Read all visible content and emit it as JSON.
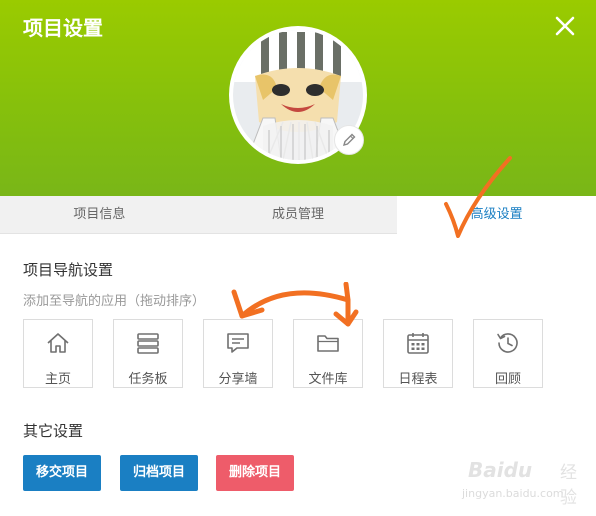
{
  "dialog": {
    "title": "项目设置"
  },
  "tabs": [
    {
      "label": "项目信息",
      "active": false
    },
    {
      "label": "成员管理",
      "active": false
    },
    {
      "label": "高级设置",
      "active": true
    }
  ],
  "nav_settings": {
    "heading": "项目导航设置",
    "hint": "添加至导航的应用（拖动排序）",
    "apps": [
      {
        "label": "主页",
        "icon": "home-icon"
      },
      {
        "label": "任务板",
        "icon": "task-board-icon"
      },
      {
        "label": "分享墙",
        "icon": "share-wall-icon"
      },
      {
        "label": "文件库",
        "icon": "folder-icon"
      },
      {
        "label": "日程表",
        "icon": "calendar-icon"
      },
      {
        "label": "回顾",
        "icon": "history-icon"
      }
    ]
  },
  "other_settings": {
    "heading": "其它设置",
    "transfer_label": "移交项目",
    "archive_label": "归档项目",
    "delete_label": "删除项目"
  },
  "watermark": {
    "brand": "Baidu",
    "suffix": "经验",
    "url": "jingyan.baidu.com"
  },
  "colors": {
    "header_green": "#8cc700",
    "accent_blue": "#1a7fc3",
    "delete_red": "#ee5c6a",
    "annotation_orange": "#f27022"
  }
}
